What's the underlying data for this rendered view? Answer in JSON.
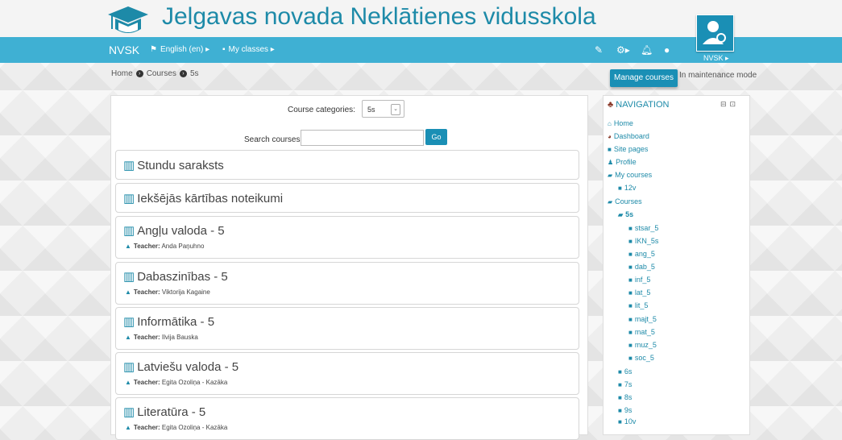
{
  "site": {
    "title": "Jelgavas novada Neklātienes vidusskola"
  },
  "navbar": {
    "brand": "NVSK",
    "language": "English (en) ▸",
    "my_classes": "My classes ▸",
    "user": "NVSK ▸",
    "icons": [
      "edit-icon",
      "gear-icon",
      "bell-icon",
      "chat-icon"
    ]
  },
  "breadcrumb": {
    "home": "Home",
    "courses": "Courses",
    "current": "5s"
  },
  "actions": {
    "manage_courses": "Manage courses",
    "maintenance": "In maintenance mode"
  },
  "filters": {
    "category_label": "Course categories:",
    "category_value": "5s",
    "search_label": "Search courses:",
    "go": "Go"
  },
  "courses": [
    {
      "name": "Stundu saraksts"
    },
    {
      "name": "Iekšējās kārtības noteikumi"
    },
    {
      "name": "Angļu valoda - 5",
      "teacher_label": "Teacher:",
      "teacher": "Anda Paņuhno"
    },
    {
      "name": "Dabaszinības - 5",
      "teacher_label": "Teacher:",
      "teacher": "Viktorija Kagaine"
    },
    {
      "name": "Informātika - 5",
      "teacher_label": "Teacher:",
      "teacher": "Ilvija Bauska"
    },
    {
      "name": "Latviešu valoda - 5",
      "teacher_label": "Teacher:",
      "teacher": "Egita Ozoliņa - Kazāka"
    },
    {
      "name": "Literatūra - 5",
      "teacher_label": "Teacher:",
      "teacher": "Egita Ozoliņa - Kazāka"
    }
  ],
  "navigation": {
    "heading": "NAVIGATION",
    "items": [
      "Home",
      "Dashboard",
      "Site pages",
      "Profile",
      "My courses",
      "12v",
      "Courses",
      "5s",
      "stsar_5",
      "IKN_5s",
      "ang_5",
      "dab_5",
      "inf_5",
      "lat_5",
      "lit_5",
      "majt_5",
      "mat_5",
      "muz_5",
      "soc_5",
      "6s",
      "7s",
      "8s",
      "9s",
      "10v"
    ]
  },
  "colors": {
    "accent": "#3fb0d3",
    "brand_text": "#1d8aa8",
    "button": "#1a8fb5"
  }
}
